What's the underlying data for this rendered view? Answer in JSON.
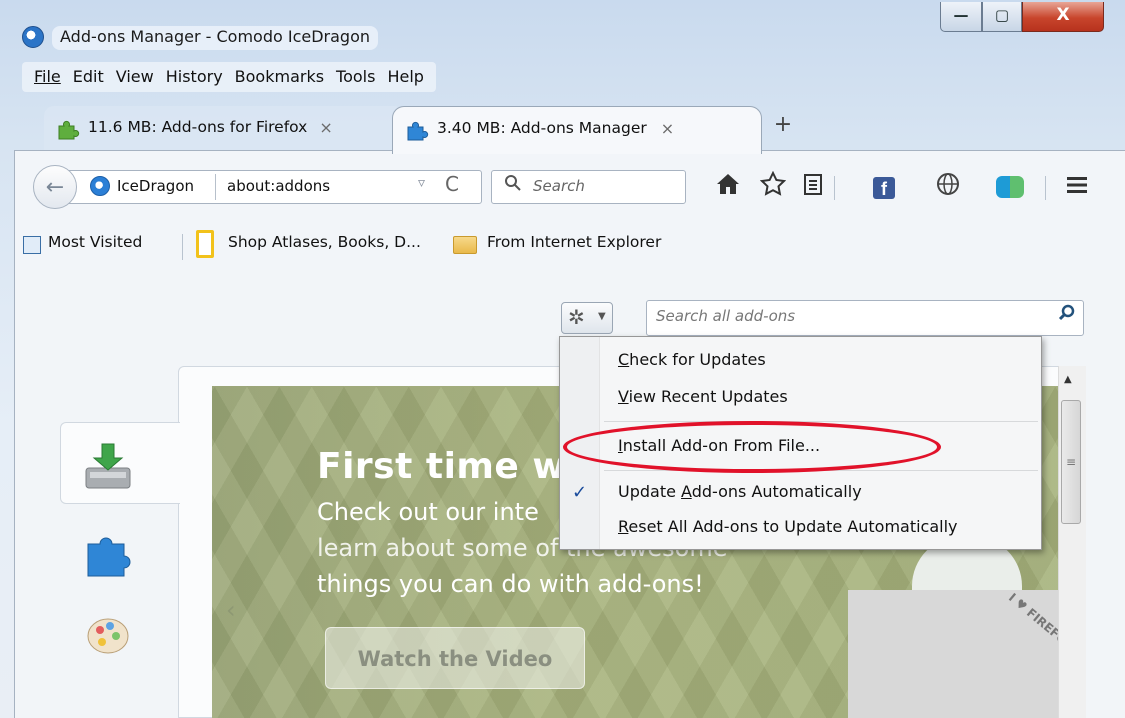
{
  "window": {
    "title": "Add-ons Manager - Comodo IceDragon",
    "minimize_glyph": "—",
    "maximize_glyph": "▢",
    "close_glyph": "X"
  },
  "menubar": {
    "items": [
      "File",
      "Edit",
      "View",
      "History",
      "Bookmarks",
      "Tools",
      "Help"
    ]
  },
  "tabs": [
    {
      "label": "11.6 MB: Add-ons for Firefox",
      "close": "×",
      "icon": "puzzle-green-icon",
      "active": false
    },
    {
      "label": "3.40 MB: Add-ons Manager",
      "close": "×",
      "icon": "puzzle-blue-icon",
      "active": true
    }
  ],
  "new_tab_glyph": "+",
  "navbar": {
    "back_glyph": "←",
    "identity": "IceDragon",
    "url": "about:addons",
    "dropdown_glyph": "▿",
    "reload_glyph": "C",
    "search_placeholder": "Search",
    "icons": [
      "home-icon",
      "bookmark-star-icon",
      "reading-list-icon",
      "facebook-icon",
      "globe-icon",
      "cloud-share-icon",
      "hamburger-menu-icon"
    ],
    "facebook_glyph": "f"
  },
  "bookmarks": {
    "items": [
      "Most Visited",
      "Shop Atlases, Books, D...",
      "From Internet Explorer"
    ]
  },
  "addons": {
    "search_placeholder": "Search all add-ons",
    "tools_menu": [
      {
        "label_pre": "",
        "accel": "C",
        "label_post": "heck for Updates",
        "checked": false
      },
      {
        "label_pre": "",
        "accel": "V",
        "label_post": "iew Recent Updates",
        "checked": false
      },
      {
        "label_pre": "",
        "accel": "I",
        "label_post": "nstall Add-on From File...",
        "checked": false,
        "highlighted": true
      },
      {
        "label_pre": "Update ",
        "accel": "A",
        "label_post": "dd-ons Automatically",
        "checked": true
      },
      {
        "label_pre": "",
        "accel": "R",
        "label_post": "eset All Add-ons to Update Automatically",
        "checked": false
      }
    ],
    "check_glyph": "✓",
    "categories": [
      "get-addons-icon",
      "extensions-icon",
      "appearance-icon"
    ],
    "banner": {
      "title": "First time wi",
      "subtitle_lines": [
        "Check out our inte",
        "learn about some of the awesome",
        "things you can do with add-ons!"
      ],
      "button": "Watch the Video",
      "badge": "I ♥ FIREFO"
    }
  },
  "colors": {
    "close_button": "#c8452c",
    "banner_green": "#a6b27c",
    "highlight_red": "#e1122a",
    "facebook_blue": "#3b5998"
  }
}
